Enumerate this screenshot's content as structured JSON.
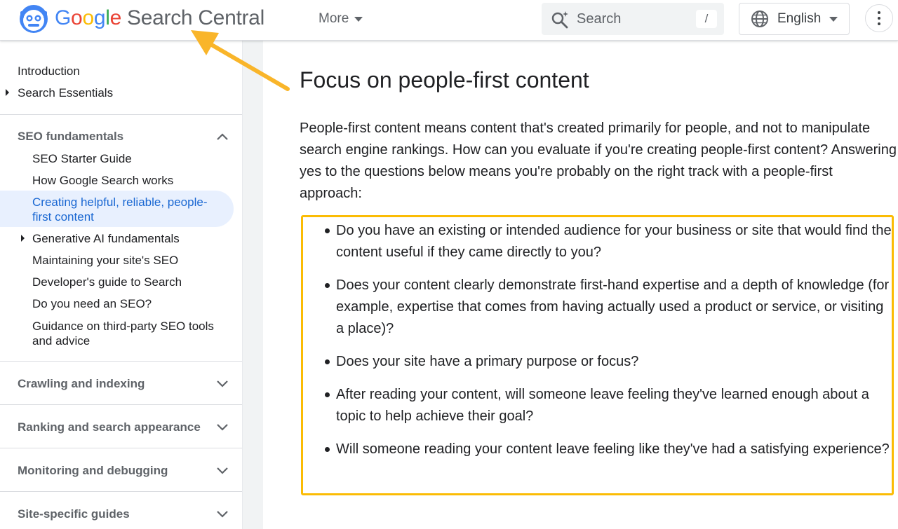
{
  "header": {
    "brand_google": [
      "G",
      "o",
      "o",
      "g",
      "l",
      "e"
    ],
    "brand_suffix": "Search Central",
    "more_label": "More",
    "search_placeholder": "Search",
    "search_shortcut": "/",
    "language": "English"
  },
  "sidebar": {
    "top_items": [
      "Introduction",
      "Search Essentials"
    ],
    "seo_section": "SEO fundamentals",
    "seo_items": [
      "SEO Starter Guide",
      "How Google Search works",
      "Creating helpful, reliable, people-first content",
      "Generative AI fundamentals",
      "Maintaining your site's SEO",
      "Developer's guide to Search",
      "Do you need an SEO?",
      "Guidance on third-party SEO tools and advice"
    ],
    "collapsed_sections": [
      "Crawling and indexing",
      "Ranking and search appearance",
      "Monitoring and debugging",
      "Site-specific guides"
    ]
  },
  "main": {
    "title": "Focus on people-first content",
    "intro": "People-first content means content that's created primarily for people, and not to manipulate search engine rankings. How can you evaluate if you're creating people-first content? Answering yes to the questions below means you're probably on the right track with a people-first approach:",
    "questions": [
      "Do you have an existing or intended audience for your business or site that would find the content useful if they came directly to you?",
      "Does your content clearly demonstrate first-hand expertise and a depth of knowledge (for example, expertise that comes from having actually used a product or service, or visiting a place)?",
      "Does your site have a primary purpose or focus?",
      "After reading your content, will someone leave feeling they've learned enough about a topic to help achieve their goal?",
      "Will someone reading your content leave feeling like they've had a satisfying experience?"
    ]
  },
  "colors": {
    "highlight": "#fbbc04",
    "active_bg": "#e8f0fe",
    "active_text": "#1967d2",
    "mascot": "#4285f4"
  }
}
